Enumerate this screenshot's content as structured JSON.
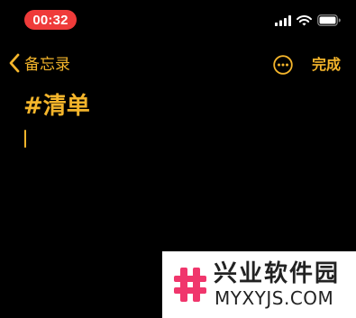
{
  "colors": {
    "accent": "#f4b52b",
    "time_pill": "#ef3b3a",
    "background": "#000000",
    "watermark_pink": "#f0366c",
    "watermark_text": "#222222"
  },
  "status_bar": {
    "time": "00:32",
    "icons": [
      "cellular-signal-icon",
      "wifi-icon",
      "battery-icon"
    ]
  },
  "nav": {
    "back_label": "备忘录",
    "back_icon": "chevron-left-icon",
    "more_icon": "ellipsis-circle-icon",
    "done_label": "完成"
  },
  "note": {
    "title": "#清单",
    "body": ""
  },
  "watermark": {
    "name": "兴业软件园",
    "url": "MYXYJS.COM"
  }
}
